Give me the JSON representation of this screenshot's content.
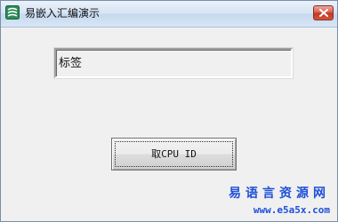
{
  "window": {
    "title": "易嵌入汇编演示",
    "app_icon": "app-logo-icon",
    "close_icon": "close-icon"
  },
  "content": {
    "label_text": "标签",
    "button_label": "取CPU ID"
  },
  "watermark": {
    "site_name": "易语言资源网",
    "site_url": "www.e5a5x.com"
  },
  "colors": {
    "watermark": "#1e4fd8",
    "close_button": "#c2361f",
    "title_bar": "#d5e3f3"
  }
}
